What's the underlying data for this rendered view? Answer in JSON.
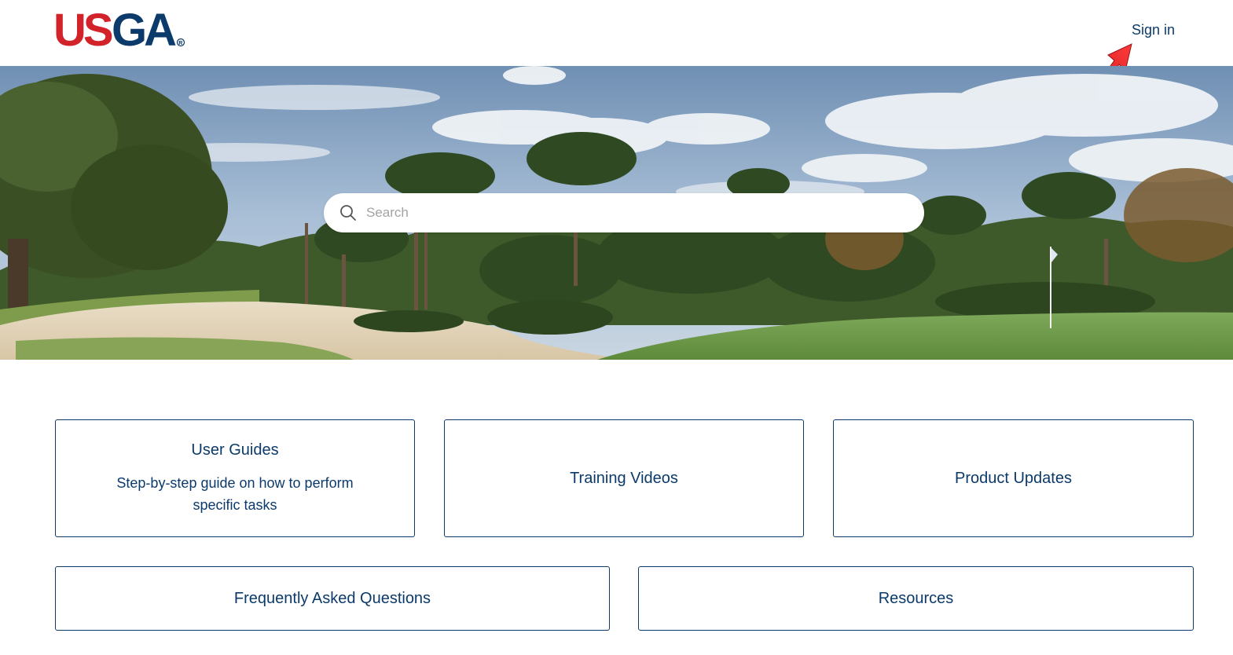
{
  "header": {
    "logo_text": "USGA",
    "logo_mark": "®",
    "signin_label": "Sign in"
  },
  "search": {
    "placeholder": "Search"
  },
  "categories": [
    {
      "title": "User Guides",
      "description": "Step-by-step guide on how to perform specific tasks"
    },
    {
      "title": "Training Videos"
    },
    {
      "title": "Product Updates"
    },
    {
      "title": "Frequently Asked Questions"
    },
    {
      "title": "Resources"
    }
  ],
  "colors": {
    "brand_red": "#d2232a",
    "brand_navy": "#0b3a6b",
    "link": "#0b3a6b",
    "annotation_arrow": "#e8262a"
  },
  "icons": {
    "search": "search-icon",
    "annotation": "arrow-annotation-icon"
  }
}
